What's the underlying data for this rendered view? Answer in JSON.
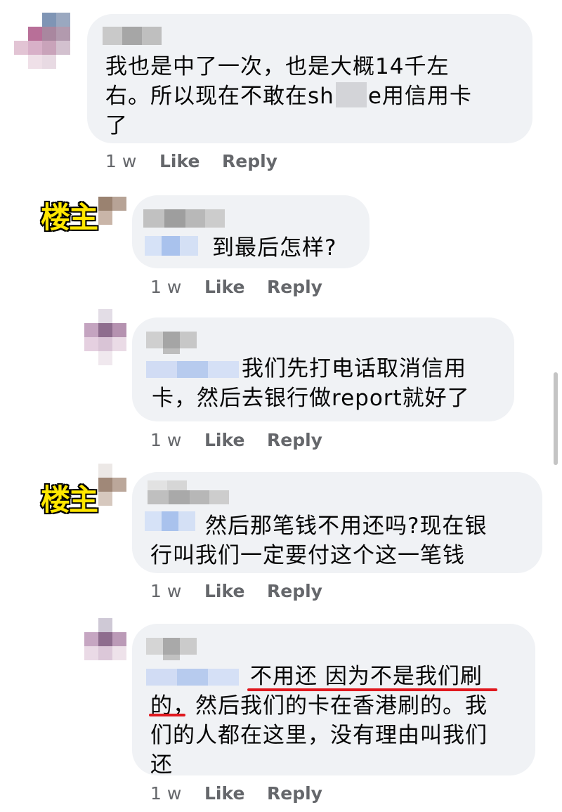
{
  "comments": [
    {
      "text_before": "我也是中了一次，也是大概14千左\n右。所以现在不敢在sh",
      "text_after": "e用信用卡\n了",
      "time": "1 w",
      "like": "Like",
      "reply": "Reply"
    },
    {
      "badge": "楼主",
      "text": "到最后怎样?",
      "time": "1 w",
      "like": "Like",
      "reply": "Reply"
    },
    {
      "text": "我们先打电话取消信用\n卡，然后去银行做report就好了",
      "time": "1 w",
      "like": "Like",
      "reply": "Reply"
    },
    {
      "badge": "楼主",
      "text": "然后那笔钱不用还吗?现在银\n行叫我们一定要付这个这一笔钱",
      "time": "1 w",
      "like": "Like",
      "reply": "Reply"
    },
    {
      "text_line1": "不用还 因为不是我们刷",
      "text_line2a": "的，",
      "text_line2b": "然后我们的卡在香港刷的。我",
      "text_rest": "们的人都在这里，没有理由叫我们\n还",
      "time": "1 w",
      "like": "Like",
      "reply": "Reply"
    }
  ],
  "colors": {
    "bubble": "#f0f2f5",
    "meta": "#65676b",
    "badge": "#ffe600",
    "underline": "#e0181e"
  }
}
